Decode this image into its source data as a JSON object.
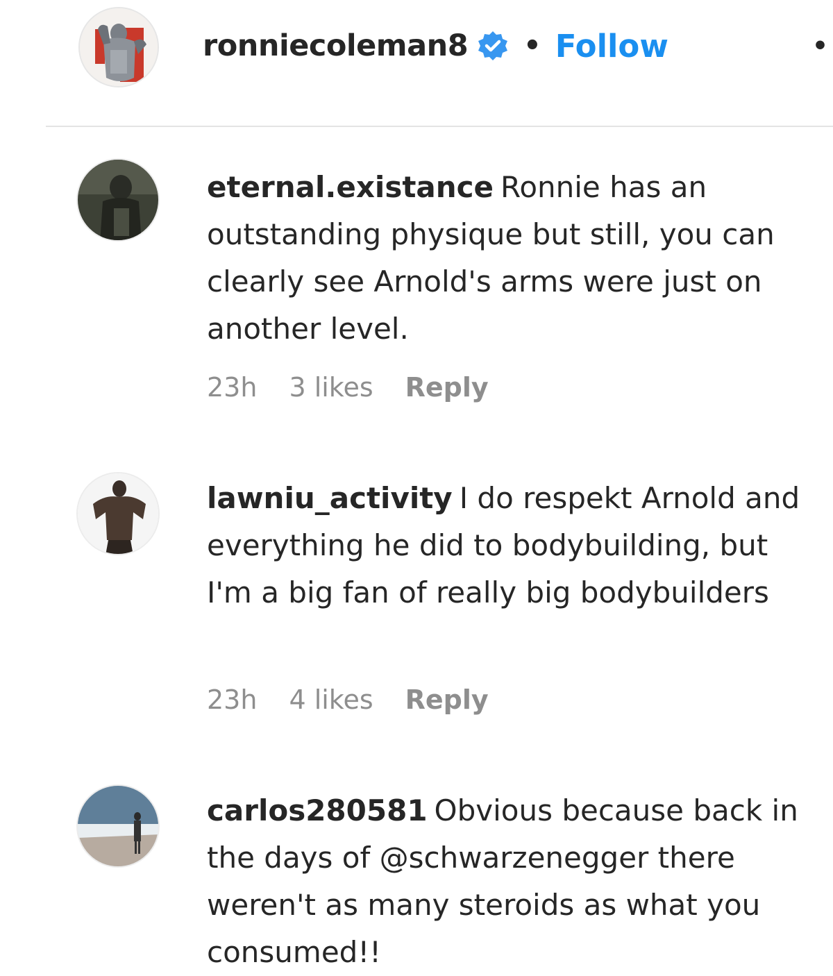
{
  "post_header": {
    "username": "ronniecoleman8",
    "separator": "•",
    "follow_label": "Follow",
    "more_label": "•",
    "verified_icon": "verified-badge-icon",
    "colors": {
      "follow": "#1a8ff0",
      "verified": "#3897f0",
      "meta": "#8e8e8e"
    }
  },
  "comments": [
    {
      "username": "eternal.existance",
      "text": "Ronnie has an outstanding physique but still, you can clearly see Arnold's arms were just on another level.",
      "time": "23h",
      "likes": "3 likes",
      "reply_label": "Reply"
    },
    {
      "username": "lawniu_activity",
      "text": "I do respekt Arnold and everything he did to bodybuilding, but I'm a big fan of really big bodybuilders",
      "time": "23h",
      "likes": "4 likes",
      "reply_label": "Reply"
    },
    {
      "username": "carlos280581",
      "text": "Obvious because back in the days of @schwarzenegger there weren't as many steroids as what you consumed!!"
    }
  ]
}
